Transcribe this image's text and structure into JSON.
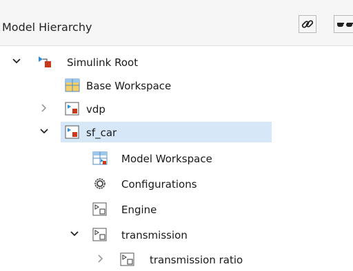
{
  "header": {
    "title": "Model Hierarchy"
  },
  "tree": {
    "simulink_root": "Simulink Root",
    "base_workspace": "Base Workspace",
    "vdp": "vdp",
    "sf_car": "sf_car",
    "model_workspace": "Model Workspace",
    "configurations": "Configurations",
    "engine": "Engine",
    "transmission": "transmission",
    "transmission_ratio": "transmission ratio"
  },
  "colors": {
    "selection": "#d6e8f8",
    "accent_blue": "#2c8fd8",
    "accent_red": "#c93a1a"
  }
}
